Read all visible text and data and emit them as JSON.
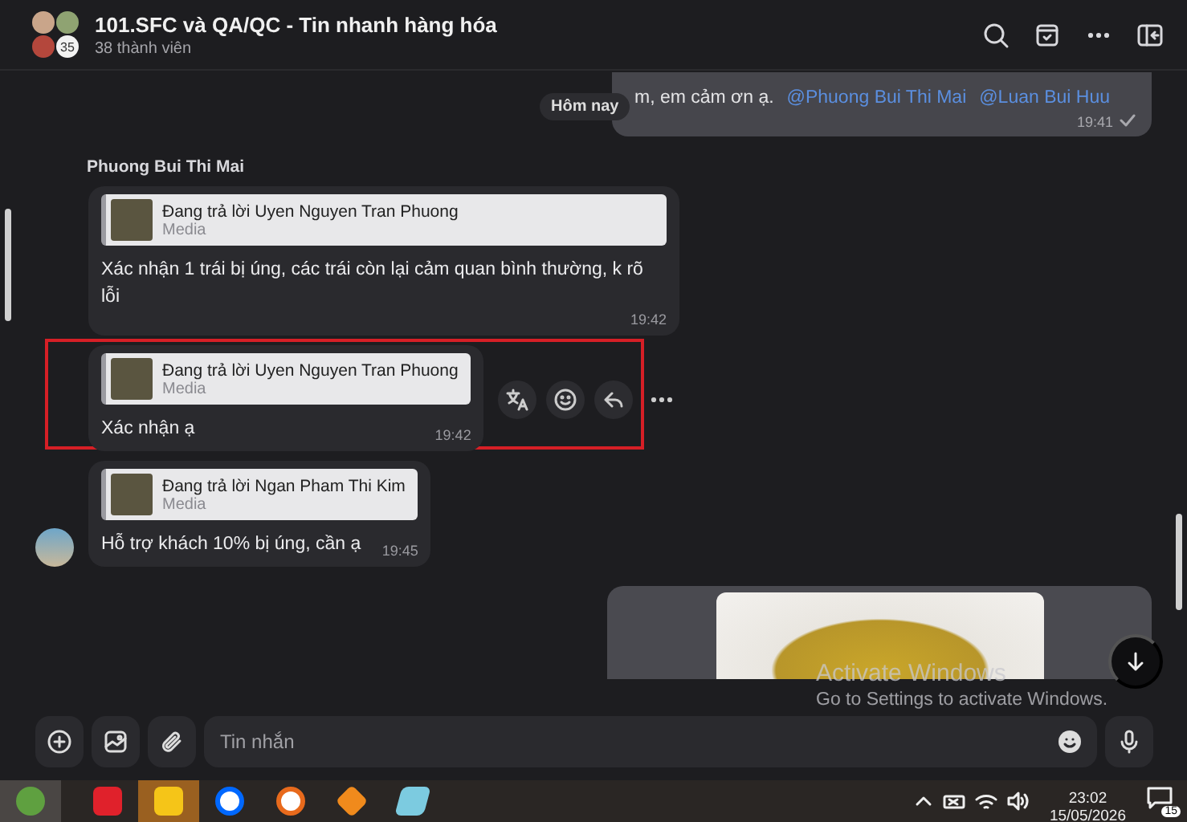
{
  "header": {
    "title": "101.SFC và QA/QC - Tin nhanh hàng hóa",
    "members": "38 thành viên",
    "avatar_count": "35"
  },
  "top_message": {
    "text": "m, em cảm ơn ạ.",
    "mentions": [
      "@Phuong Bui Thi Mai",
      "@Luan Bui Huu"
    ],
    "time": "19:41",
    "delivered": true
  },
  "date_pill": "Hôm nay",
  "sender": "Phuong Bui Thi Mai",
  "messages": [
    {
      "reply_to": "Đang trả lời Uyen Nguyen Tran Phuong",
      "reply_kind": "Media",
      "text": "Xác nhận 1 trái bị úng, các trái còn lại cảm quan bình thường, k rõ lỗi",
      "time": "19:42",
      "highlighted": false,
      "avatar": false
    },
    {
      "reply_to": "Đang trả lời Uyen Nguyen Tran Phuong",
      "reply_kind": "Media",
      "text": "Xác nhận ạ",
      "time": "19:42",
      "highlighted": true,
      "avatar": false
    },
    {
      "reply_to": "Đang trả lời Ngan Pham Thi Kim",
      "reply_kind": "Media",
      "text": "Hỗ trợ khách 10% bị úng, cần ạ",
      "time": "19:45",
      "highlighted": false,
      "avatar": true
    }
  ],
  "composer": {
    "placeholder": "Tin nhắn"
  },
  "activation_notice": {
    "title": "Activate Windows",
    "subtitle": "Go to Settings to activate Windows."
  },
  "taskbar": {
    "time": "23:02",
    "date": "15/05/2026",
    "notification_count": "15"
  }
}
